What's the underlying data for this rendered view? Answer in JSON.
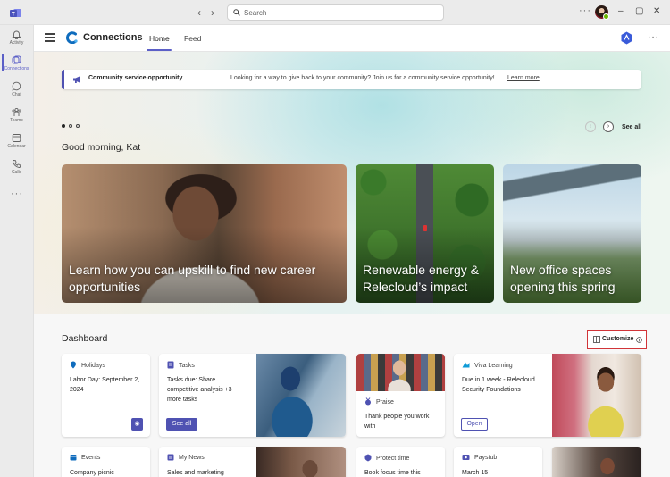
{
  "titlebar": {
    "search_placeholder": "Search"
  },
  "rail": {
    "items": [
      {
        "label": "Activity",
        "icon": "bell-icon"
      },
      {
        "label": "Connections",
        "icon": "connections-icon"
      },
      {
        "label": "Chat",
        "icon": "chat-icon"
      },
      {
        "label": "Teams",
        "icon": "teams-icon"
      },
      {
        "label": "Calendar",
        "icon": "calendar-icon"
      },
      {
        "label": "Calls",
        "icon": "phone-icon"
      }
    ]
  },
  "app": {
    "title": "Connections",
    "tabs": [
      {
        "label": "Home",
        "active": true
      },
      {
        "label": "Feed",
        "active": false
      }
    ]
  },
  "banner": {
    "title": "Community service opportunity",
    "text": "Looking for a way to give back to your community? Join us for a community service opportunity!",
    "link": "Learn more"
  },
  "hero": {
    "see_all": "See all",
    "greeting": "Good morning, Kat",
    "cards": [
      {
        "caption": "Learn how you can upskill to find new career opportunities"
      },
      {
        "caption": "Renewable energy & Relecloud’s impact"
      },
      {
        "caption": "New office spaces opening this spring"
      }
    ]
  },
  "dashboard": {
    "title": "Dashboard",
    "customize": "Customize",
    "cards": {
      "holidays": {
        "header": "Holidays",
        "body": "Labor Day: September 2, 2024"
      },
      "tasks": {
        "header": "Tasks",
        "body": "Tasks due: Share competitive analysis +3 more tasks",
        "button": "See all"
      },
      "praise": {
        "header": "Praise",
        "body": "Thank people you work with"
      },
      "viva": {
        "header": "Viva Learning",
        "body": "Due in 1 week - Relecloud Security Foundations",
        "button": "Open"
      },
      "events": {
        "header": "Events",
        "body": "Company picnic"
      },
      "mynews": {
        "header": "My News",
        "body": "Sales and marketing"
      },
      "protect": {
        "header": "Protect time",
        "body": "Book focus time this"
      },
      "paystub": {
        "header": "Paystub",
        "body": "March 15"
      }
    }
  },
  "colors": {
    "accent": "#5b5fc7",
    "brand_button": "#4f52b2",
    "highlight_border": "#d13438"
  }
}
